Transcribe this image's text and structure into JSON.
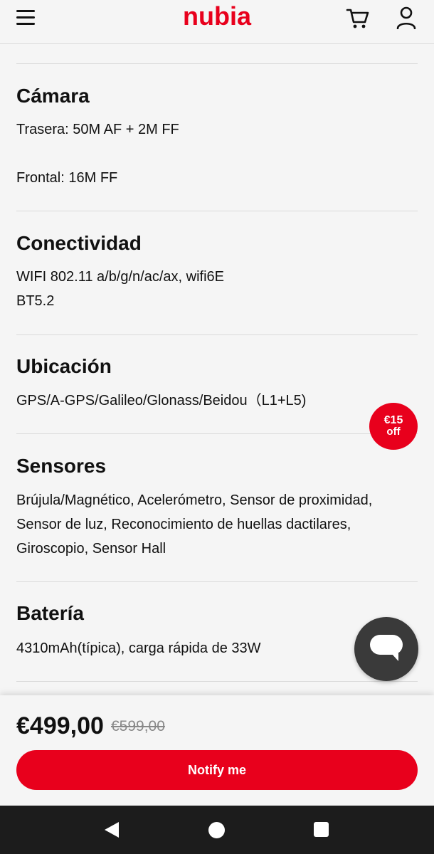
{
  "header": {
    "logo": "nubia",
    "icons": [
      "hamburger-menu-icon",
      "shopping-cart-icon",
      "user-account-icon"
    ]
  },
  "specs": [
    {
      "title": "Cámara",
      "lines": [
        "Trasera: 50M AF + 2M FF",
        "",
        "Frontal: 16M FF"
      ]
    },
    {
      "title": "Conectividad",
      "lines": [
        "WIFI 802.11 a/b/g/n/ac/ax, wifi6E",
        "BT5.2"
      ]
    },
    {
      "title": "Ubicación",
      "lines": [
        "GPS/A-GPS/Galileo/Glonass/Beidou（L1+L5)"
      ]
    },
    {
      "title": "Sensores",
      "lines": [
        "Brújula/Magnético, Acelerómetro, Sensor de proximidad,",
        "Sensor de luz, Reconocimiento de huellas dactilares,",
        "Giroscopio, Sensor Hall"
      ]
    },
    {
      "title": "Batería",
      "lines": [
        "4310mAh(típica), carga rápida de 33W"
      ]
    }
  ],
  "discount_badge": {
    "amount": "€15",
    "label": "off"
  },
  "price": {
    "current": "€499,00",
    "original": "€599,00"
  },
  "cta": {
    "label": "Notify me"
  },
  "colors": {
    "brand": "#e8001c",
    "chat_button": "#3a3a3a",
    "nav_bar": "#1c1c1c"
  }
}
